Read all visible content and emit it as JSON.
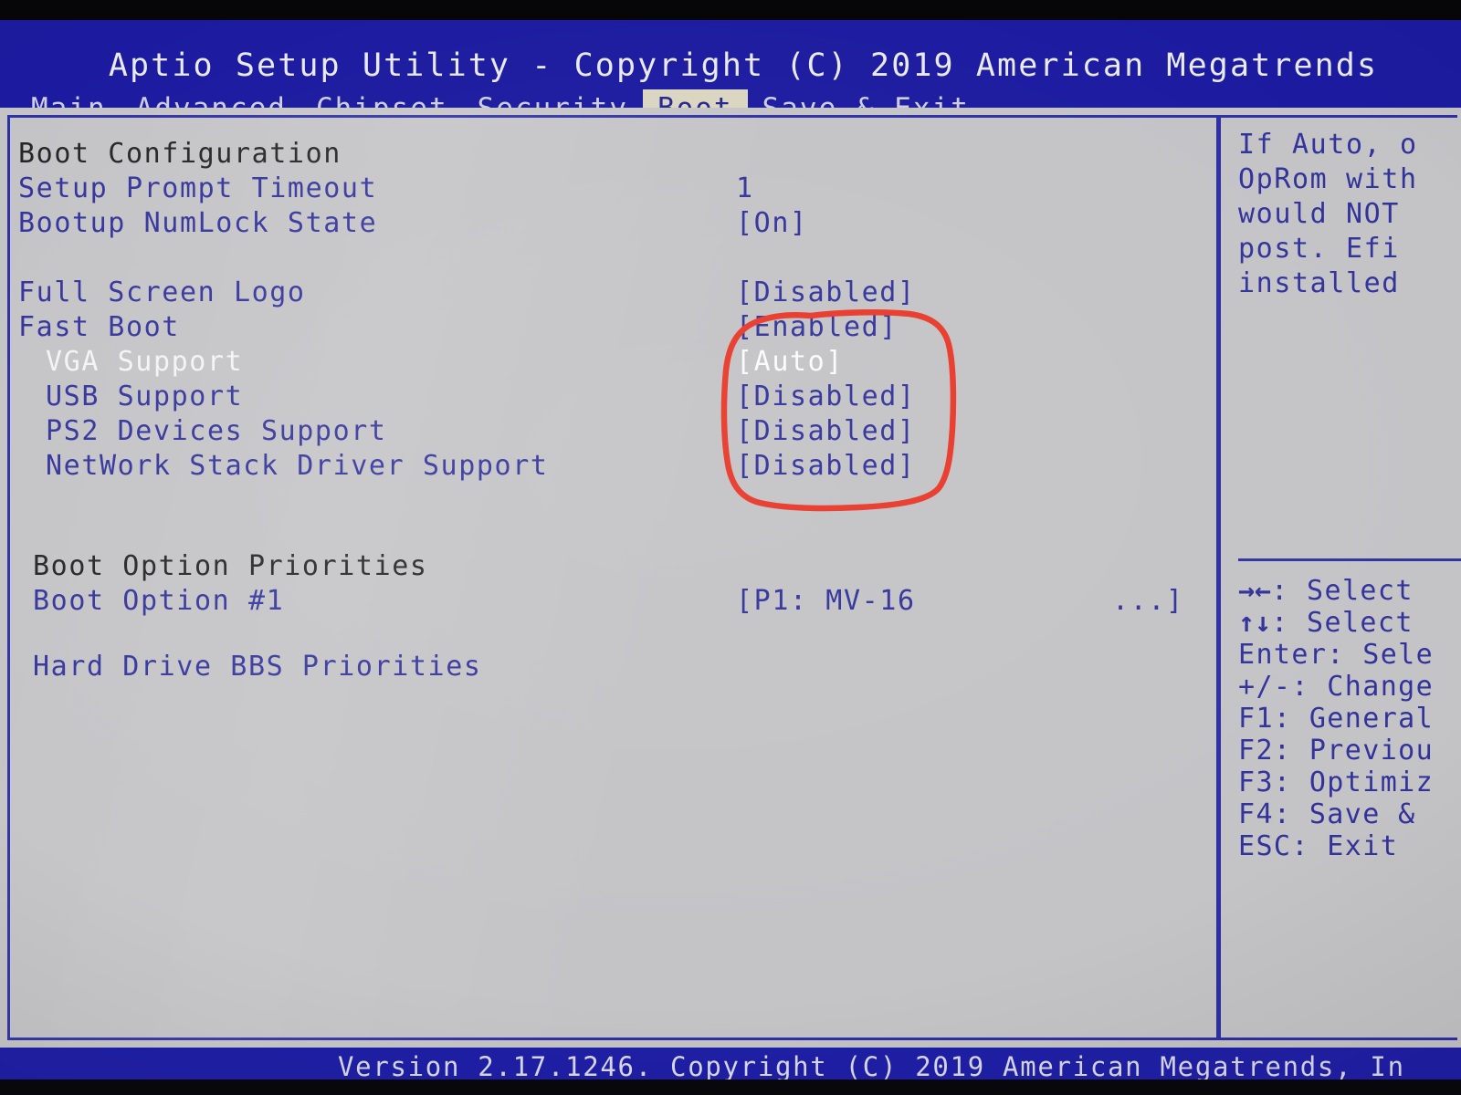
{
  "window": {
    "title": "Aptio Setup Utility - Copyright (C) 2019 American Megatrends",
    "footer": "Version 2.17.1246. Copyright (C) 2019 American Megatrends, In"
  },
  "colors": {
    "header_blue": "#1c1ba0",
    "panel_bg": "#c4c4c7",
    "text_blue": "#32329b",
    "selected_white": "#f4f4f4",
    "section_header": "#232326",
    "annotation_red": "#e8392a",
    "active_tab_bg": "#d9d5c1"
  },
  "tabs": [
    {
      "label": "Main",
      "active": false
    },
    {
      "label": "Advanced",
      "active": false
    },
    {
      "label": "Chipset",
      "active": false
    },
    {
      "label": "Security",
      "active": false
    },
    {
      "label": "Boot",
      "active": true
    },
    {
      "label": "Save & Exit",
      "active": false
    }
  ],
  "settings": [
    {
      "label": "Boot Configuration",
      "value": "",
      "kind": "header",
      "indent": 0,
      "selected": false
    },
    {
      "label": "Setup Prompt Timeout",
      "value": "1",
      "kind": "item",
      "indent": 0,
      "selected": false
    },
    {
      "label": "Bootup NumLock State",
      "value": "[On]",
      "kind": "item",
      "indent": 0,
      "selected": false
    },
    {
      "label": "Full Screen Logo",
      "value": "[Disabled]",
      "kind": "item",
      "indent": 0,
      "selected": false
    },
    {
      "label": "Fast Boot",
      "value": "[Enabled]",
      "kind": "item",
      "indent": 0,
      "selected": false
    },
    {
      "label": "VGA Support",
      "value": "[Auto]",
      "kind": "item",
      "indent": 1,
      "selected": true
    },
    {
      "label": "USB Support",
      "value": "[Disabled]",
      "kind": "item",
      "indent": 1,
      "selected": false
    },
    {
      "label": "PS2 Devices Support",
      "value": "[Disabled]",
      "kind": "item",
      "indent": 1,
      "selected": false
    },
    {
      "label": "NetWork Stack Driver Support",
      "value": "[Disabled]",
      "kind": "item",
      "indent": 1,
      "selected": false
    },
    {
      "label": "Boot Option Priorities",
      "value": "",
      "kind": "header",
      "indent": 0,
      "selected": false
    },
    {
      "label": "Boot Option #1",
      "value": "[P1: MV-16",
      "value_tail": "...]",
      "kind": "item",
      "indent": 0,
      "selected": false
    },
    {
      "label": "Hard Drive BBS Priorities",
      "value": "",
      "kind": "item",
      "indent": 0,
      "selected": false
    }
  ],
  "help": {
    "lines": [
      "If Auto, o",
      "OpRom with",
      "would NOT",
      "post. Efi",
      "installed"
    ]
  },
  "keys": [
    {
      "glyph": "→←",
      "text": ": Select"
    },
    {
      "glyph": "↑↓",
      "text": ": Select"
    },
    {
      "glyph": "",
      "text": "Enter: Sele"
    },
    {
      "glyph": "",
      "text": "+/-: Change"
    },
    {
      "glyph": "",
      "text": "F1: General"
    },
    {
      "glyph": "",
      "text": "F2: Previou"
    },
    {
      "glyph": "",
      "text": "F3: Optimiz"
    },
    {
      "glyph": "",
      "text": "F4: Save &"
    },
    {
      "glyph": "",
      "text": "ESC: Exit"
    }
  ],
  "annotation": {
    "shape": "hand-drawn-red-circle",
    "encircles": [
      "[Enabled]",
      "[Auto]",
      "[Disabled]",
      "[Disabled]",
      "[Disabled]"
    ]
  }
}
